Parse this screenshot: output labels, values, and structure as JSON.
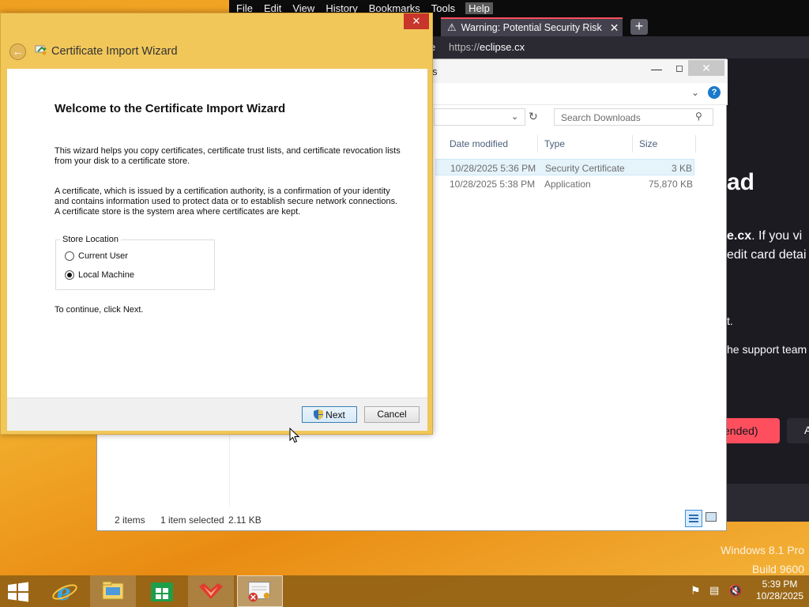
{
  "browser": {
    "menu": [
      "File",
      "Edit",
      "View",
      "History",
      "Bookmarks",
      "Tools",
      "Help"
    ],
    "tab_title": "Warning: Potential Security Risk",
    "tab_close": "✕",
    "new_tab": "+",
    "url_fragment": "e",
    "url_prefix": "https://",
    "url_host": "eclipse.cx",
    "content": {
      "frag_ad": "ad",
      "frag_cx_bold": "e.cx",
      "frag_cx_rest": ". If you vi",
      "frag_edit": "edit card detai",
      "frag_t": "t.",
      "frag_support": "he support team",
      "btn_recommended": "ended)",
      "btn_advanced": "A"
    }
  },
  "explorer": {
    "title_fragment": "s",
    "search_placeholder": "Search Downloads",
    "columns": [
      "Date modified",
      "Type",
      "Size"
    ],
    "rows": [
      {
        "date": "10/28/2025 5:36 PM",
        "type": "Security Certificate",
        "size": "3 KB",
        "selected": true
      },
      {
        "date": "10/28/2025 5:38 PM",
        "type": "Application",
        "size": "75,870 KB",
        "selected": false
      }
    ],
    "status": {
      "items": "2 items",
      "selected": "1 item selected",
      "size": "2.11 KB"
    }
  },
  "wizard": {
    "window_title": "Certificate Import Wizard",
    "close_label": "✕",
    "heading": "Welcome to the Certificate Import Wizard",
    "para1": "This wizard helps you copy certificates, certificate trust lists, and certificate revocation lists from your disk to a certificate store.",
    "para2": "A certificate, which is issued by a certification authority, is a confirmation of your identity and contains information used to protect data or to establish secure network connections. A certificate store is the system area where certificates are kept.",
    "store_location_label": "Store Location",
    "options": [
      {
        "label": "Current User",
        "selected": false
      },
      {
        "label": "Local Machine",
        "selected": true
      }
    ],
    "continue_text": "To continue, click Next.",
    "next_label": "Next",
    "cancel_label": "Cancel"
  },
  "watermark": {
    "line1": "Windows 8.1 Pro",
    "line2": "Build 9600"
  },
  "taskbar": {
    "time": "5:39 PM",
    "date": "10/28/2025"
  },
  "colors": {
    "desktop": "#f3b130",
    "wizard_frame": "#f1c75a",
    "close_red": "#c7352b",
    "firefox_warning_red": "#ff4f5e",
    "selection_blue": "#e5f3fb"
  }
}
